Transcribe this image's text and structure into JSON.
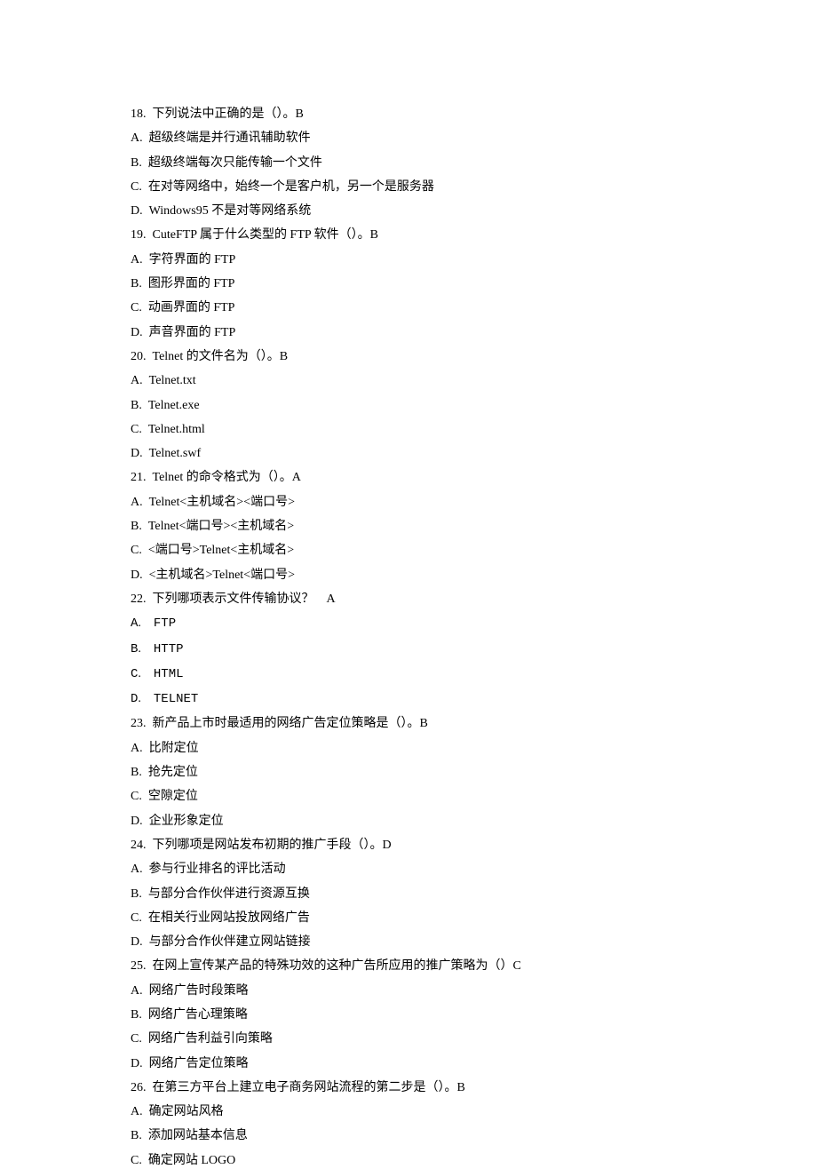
{
  "questions": [
    {
      "num": "18",
      "stem": "下列说法中正确的是（）。B",
      "options": [
        {
          "letter": "A",
          "text": "超级终端是并行通讯辅助软件"
        },
        {
          "letter": "B",
          "text": "超级终端每次只能传输一个文件"
        },
        {
          "letter": "C",
          "text": "在对等网络中，始终一个是客户机，另一个是服务器"
        },
        {
          "letter": "D",
          "text": "Windows95 不是对等网络系统"
        }
      ]
    },
    {
      "num": "19",
      "stem": "CuteFTP 属于什么类型的 FTP 软件（）。B",
      "options": [
        {
          "letter": "A",
          "text": "字符界面的 FTP"
        },
        {
          "letter": "B",
          "text": "图形界面的 FTP"
        },
        {
          "letter": "C",
          "text": "动画界面的 FTP"
        },
        {
          "letter": "D",
          "text": "声音界面的 FTP"
        }
      ]
    },
    {
      "num": "20",
      "stem": "Telnet 的文件名为（）。B",
      "options": [
        {
          "letter": "A",
          "text": "Telnet.txt"
        },
        {
          "letter": "B",
          "text": "Telnet.exe"
        },
        {
          "letter": "C",
          "text": "Telnet.html"
        },
        {
          "letter": "D",
          "text": "Telnet.swf"
        }
      ]
    },
    {
      "num": "21",
      "stem": "Telnet 的命令格式为（）。A",
      "options": [
        {
          "letter": "A",
          "text": "Telnet<主机域名><端口号>"
        },
        {
          "letter": "B",
          "text": "Telnet<端口号><主机域名>"
        },
        {
          "letter": "C",
          "text": "<端口号>Telnet<主机域名>"
        },
        {
          "letter": "D",
          "text": "<主机域名>Telnet<端口号>"
        }
      ]
    },
    {
      "num": "22",
      "stem": "下列哪项表示文件传输协议？ A",
      "optionsMono": true,
      "options": [
        {
          "letter": "A",
          "text": "FTP"
        },
        {
          "letter": "B",
          "text": "HTTP"
        },
        {
          "letter": "C",
          "text": "HTML"
        },
        {
          "letter": "D",
          "text": "TELNET"
        }
      ]
    },
    {
      "num": "23",
      "stem": "新产品上市时最适用的网络广告定位策略是（）。B",
      "options": [
        {
          "letter": "A",
          "text": "比附定位"
        },
        {
          "letter": "B",
          "text": "抢先定位"
        },
        {
          "letter": "C",
          "text": "空隙定位"
        },
        {
          "letter": "D",
          "text": "企业形象定位"
        }
      ]
    },
    {
      "num": "24",
      "stem": "下列哪项是网站发布初期的推广手段（）。D",
      "options": [
        {
          "letter": "A",
          "text": "参与行业排名的评比活动"
        },
        {
          "letter": "B",
          "text": "与部分合作伙伴进行资源互换"
        },
        {
          "letter": "C",
          "text": "在相关行业网站投放网络广告"
        },
        {
          "letter": "D",
          "text": "与部分合作伙伴建立网站链接"
        }
      ]
    },
    {
      "num": "25",
      "stem": "在网上宣传某产品的特殊功效的这种广告所应用的推广策略为（）C",
      "options": [
        {
          "letter": "A",
          "text": "网络广告时段策略"
        },
        {
          "letter": "B",
          "text": "网络广告心理策略"
        },
        {
          "letter": "C",
          "text": "网络广告利益引向策略"
        },
        {
          "letter": "D",
          "text": "网络广告定位策略"
        }
      ]
    },
    {
      "num": "26",
      "stem": "在第三方平台上建立电子商务网站流程的第二步是（）。B",
      "options": [
        {
          "letter": "A",
          "text": "确定网站风格"
        },
        {
          "letter": "B",
          "text": "添加网站基本信息"
        },
        {
          "letter": "C",
          "text": "确定网站 LOGO"
        }
      ]
    }
  ]
}
